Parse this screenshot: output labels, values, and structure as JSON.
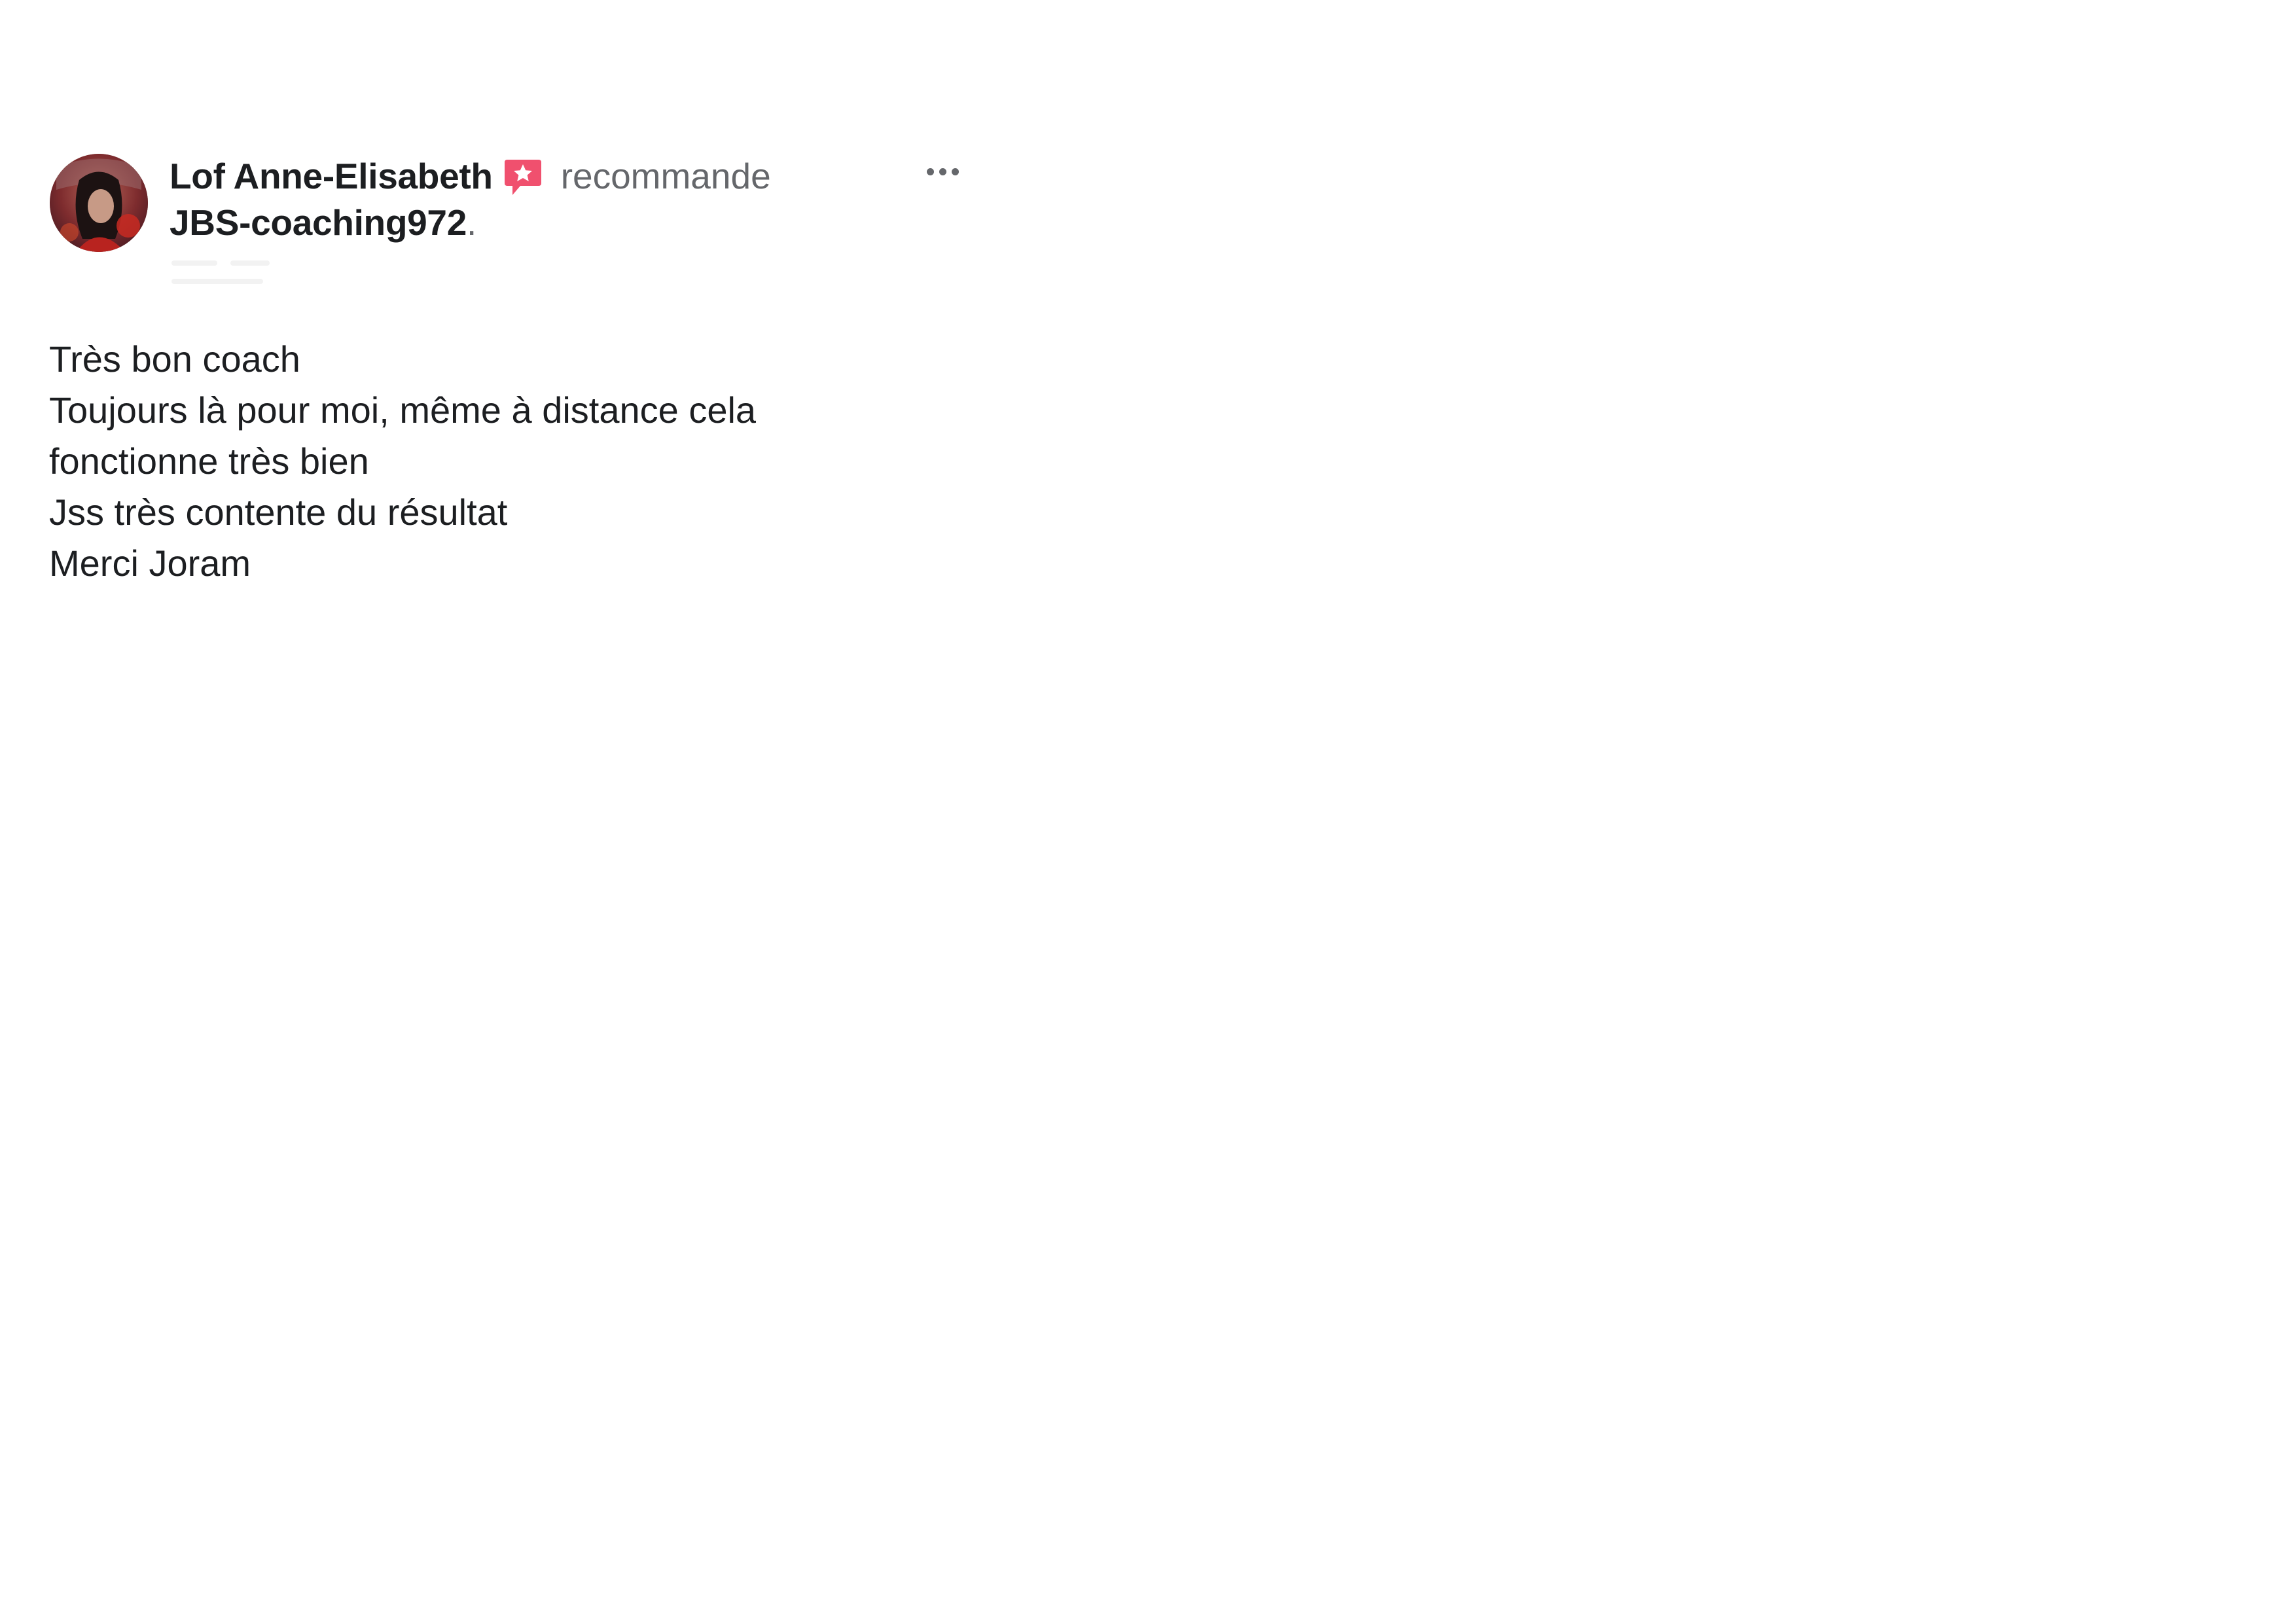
{
  "post": {
    "author": {
      "name": "Lof Anne-Elisabeth",
      "avatar_icon": "profile-photo"
    },
    "action": {
      "icon": "recommend-star-bubble-icon",
      "icon_color": "#f0506e",
      "text": "recommande"
    },
    "page_name": "JBS-coaching972",
    "page_name_suffix": ".",
    "more_icon": "more-horizontal-icon",
    "review_lines": [
      "Très bon coach",
      "Toujours là pour moi, même à distance cela",
      "fonctionne très bien",
      "Jss très contente du résultat",
      "Merci Joram"
    ]
  },
  "colors": {
    "text_primary": "#1c1e21",
    "text_secondary": "#65676b",
    "recommend_accent": "#f0506e",
    "background": "#ffffff"
  }
}
